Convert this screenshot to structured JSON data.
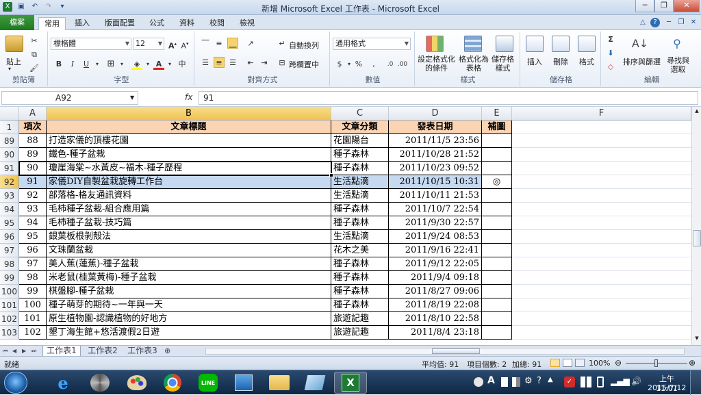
{
  "window": {
    "title": "新增 Microsoft Excel 工作表 - Microsoft Excel"
  },
  "ribbon_tabs": [
    "檔案",
    "常用",
    "插入",
    "版面配置",
    "公式",
    "資料",
    "校閱",
    "檢視"
  ],
  "ribbon": {
    "clipboard": {
      "paste": "貼上",
      "label": "剪貼簿"
    },
    "font": {
      "name": "標楷體",
      "size": "12",
      "label": "字型",
      "bold": "B",
      "italic": "I",
      "underline": "U"
    },
    "alignment": {
      "wrap": "自動換列",
      "merge": "跨欄置中",
      "label": "對齊方式"
    },
    "number": {
      "format": "通用格式",
      "label": "數值",
      "currency": "$",
      "percent": "%"
    },
    "styles": {
      "cond": [
        "設定格式化",
        "的條件"
      ],
      "table": [
        "格式化為",
        "表格"
      ],
      "cell": [
        "儲存格",
        "樣式"
      ],
      "label": "樣式"
    },
    "cells": {
      "insert": "插入",
      "delete": "刪除",
      "format": "格式",
      "label": "儲存格"
    },
    "editing": {
      "sort": [
        "排序與篩選"
      ],
      "find": [
        "尋找與",
        "選取"
      ],
      "label": "編輯"
    }
  },
  "formula_bar": {
    "name_box": "A92",
    "fx": "fx",
    "value": "91"
  },
  "columns": [
    "A",
    "B",
    "C",
    "D",
    "E",
    "F"
  ],
  "header_row": {
    "row": "1",
    "cells": [
      "項次",
      "文章標題",
      "文章分類",
      "發表日期",
      "補圖",
      ""
    ]
  },
  "rows": [
    {
      "row": "89",
      "cells": [
        "88",
        "打造家儀的頂樓花園",
        "花園陽台",
        "2011/11/5 23:56",
        ""
      ]
    },
    {
      "row": "90",
      "cells": [
        "89",
        "鐵色-種子盆栽",
        "種子森林",
        "2011/10/28 21:52",
        ""
      ]
    },
    {
      "row": "91",
      "cells": [
        "90",
        "瓊崖海棠~水黃皮~福木-種子歷程",
        "種子森林",
        "2011/10/23 09:52",
        ""
      ]
    },
    {
      "row": "92",
      "cells": [
        "91",
        "家儀DIY自製盆栽旋轉工作台",
        "生活點滴",
        "2011/10/15 10:31",
        "◎"
      ]
    },
    {
      "row": "93",
      "cells": [
        "92",
        "部落格-格友通訊資料",
        "生活點滴",
        "2011/10/11 21:53",
        ""
      ]
    },
    {
      "row": "94",
      "cells": [
        "93",
        "毛柿種子盆栽-組合應用篇",
        "種子森林",
        "2011/10/7 22:54",
        ""
      ]
    },
    {
      "row": "95",
      "cells": [
        "94",
        "毛柿種子盆栽-技巧篇",
        "種子森林",
        "2011/9/30 22:57",
        ""
      ]
    },
    {
      "row": "96",
      "cells": [
        "95",
        "銀葉板根剝殼法",
        "生活點滴",
        "2011/9/24 08:53",
        ""
      ]
    },
    {
      "row": "97",
      "cells": [
        "96",
        "文珠蘭盆栽",
        "花木之美",
        "2011/9/16 22:41",
        ""
      ]
    },
    {
      "row": "98",
      "cells": [
        "97",
        "美人蕉(蓮蕉)-種子盆栽",
        "種子森林",
        "2011/9/12 22:05",
        ""
      ]
    },
    {
      "row": "99",
      "cells": [
        "98",
        "米老鼠(桂葉黃梅)-種子盆栽",
        "種子森林",
        "2011/9/4 09:18",
        ""
      ]
    },
    {
      "row": "100",
      "cells": [
        "99",
        "棋盤腳-種子盆栽",
        "種子森林",
        "2011/8/27 09:06",
        ""
      ]
    },
    {
      "row": "101",
      "cells": [
        "100",
        "種子萌芽的期待~一年與一天",
        "種子森林",
        "2011/8/19 22:08",
        ""
      ]
    },
    {
      "row": "102",
      "cells": [
        "101",
        "原生植物園-認識植物的好地方",
        "旅遊記趣",
        "2011/8/10 22:58",
        ""
      ]
    },
    {
      "row": "103",
      "cells": [
        "102",
        "墾丁海生館+悠活渡假2日遊",
        "旅遊記趣",
        "2011/8/4 23:18",
        ""
      ]
    }
  ],
  "sheet_tabs": [
    "工作表1",
    "工作表2",
    "工作表3"
  ],
  "status": {
    "mode": "就緒",
    "average": "平均值: 91",
    "count": "項目個數: 2",
    "sum": "加總: 91",
    "zoom": "100%"
  },
  "taskbar": {
    "time": "上午 11:01",
    "date": "2015/7/12"
  },
  "colors": {
    "header_fill": "#fbd4b4",
    "selection": "#c5d9f1",
    "file_tab": "#1d7a1f"
  }
}
